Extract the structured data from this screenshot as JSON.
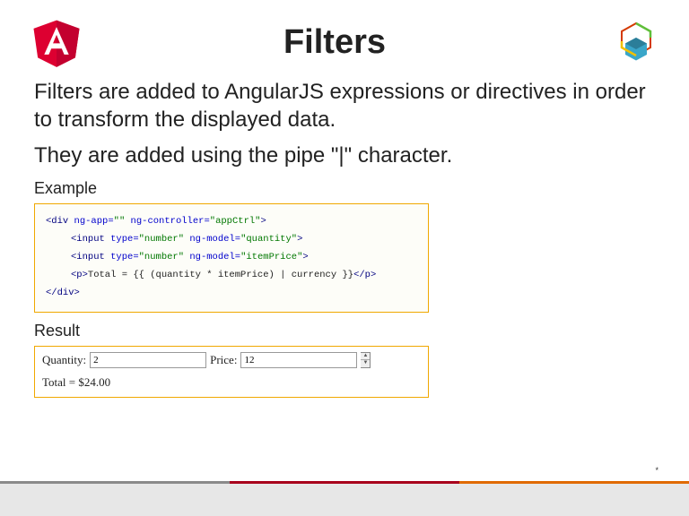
{
  "title": "Filters",
  "para1": "Filters are added to AngularJS expressions or directives in order to transform the displayed data.",
  "para2": "They are added using the pipe \"|\" character.",
  "exampleLabel": "Example",
  "resultLabel": "Result",
  "code": {
    "l1a": "<div",
    "l1b": " ng-app=",
    "l1c": "\"\"",
    "l1d": " ng-controller=",
    "l1e": "\"appCtrl\"",
    "l1f": ">",
    "l2a": "<input",
    "l2b": " type=",
    "l2c": "\"number\"",
    "l2d": " ng-model=",
    "l2e": "\"quantity\"",
    "l2f": ">",
    "l3a": "<input",
    "l3b": " type=",
    "l3c": "\"number\"",
    "l3d": " ng-model=",
    "l3e": "\"itemPrice\"",
    "l3f": ">",
    "l4a": "<p>",
    "l4b": "Total = {{ (quantity * itemPrice) | currency }}",
    "l4c": "</p>",
    "l5": "</div>"
  },
  "result": {
    "quantityLabel": "Quantity:",
    "quantityValue": "2",
    "priceLabel": "Price:",
    "priceValue": "12",
    "totalText": "Total = $24.00"
  }
}
